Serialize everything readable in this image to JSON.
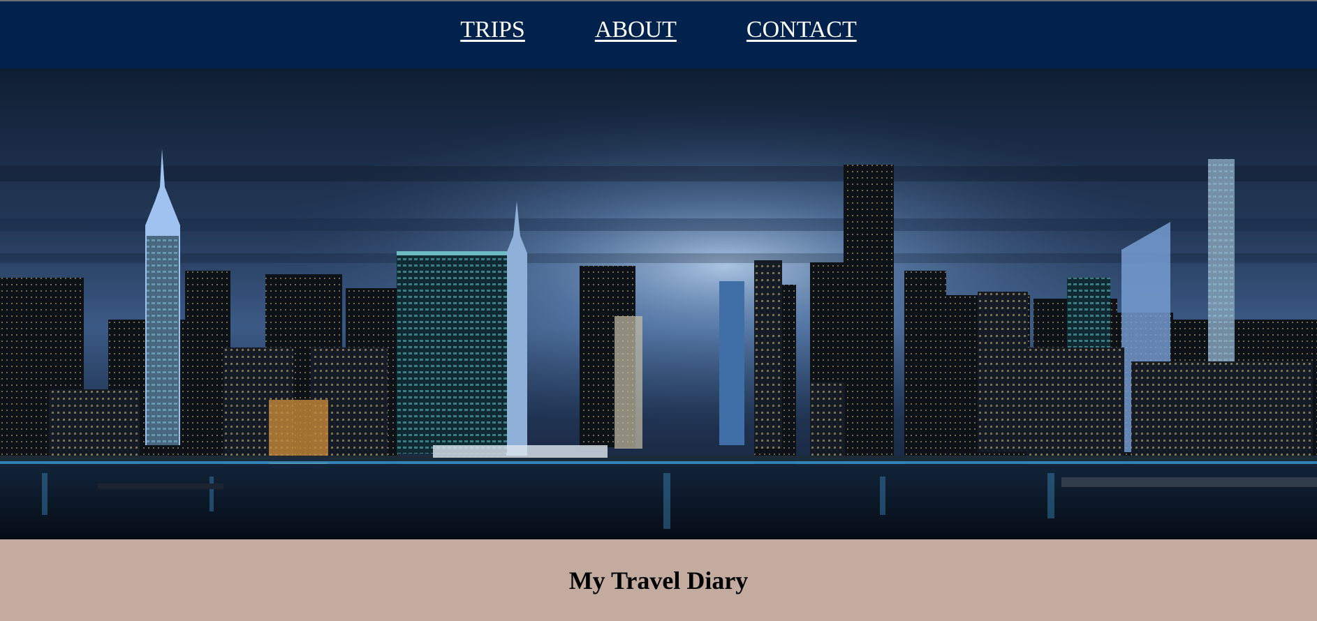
{
  "nav": {
    "items": [
      {
        "label": "TRIPS"
      },
      {
        "label": "ABOUT"
      },
      {
        "label": "CONTACT"
      }
    ]
  },
  "hero": {
    "image": "night-city-skyline-photo"
  },
  "footer": {
    "title": "My Travel Diary"
  },
  "colors": {
    "nav_background": "#00224c",
    "nav_text": "#ffffff",
    "footer_background": "#c4aba0",
    "footer_text": "#000000"
  }
}
